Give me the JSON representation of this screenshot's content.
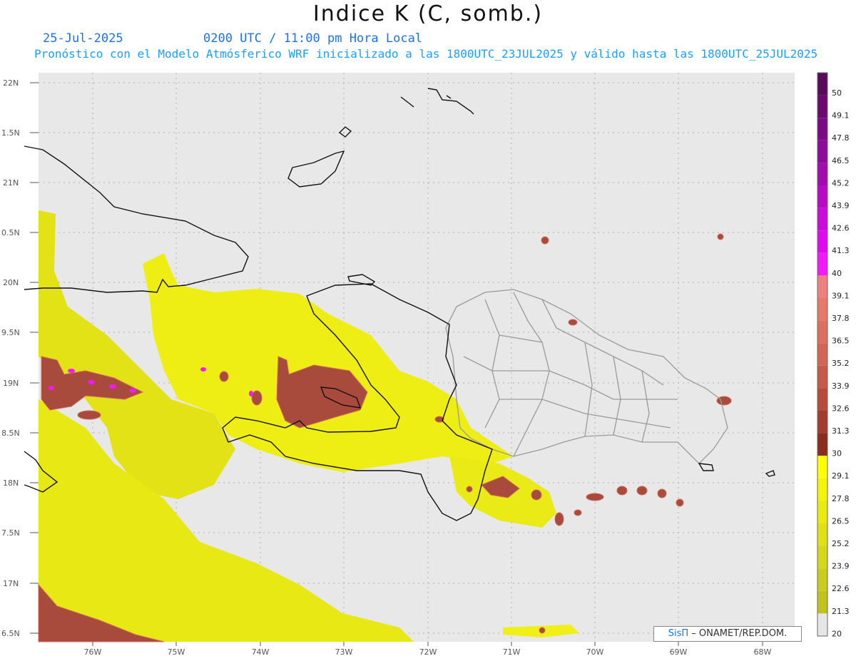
{
  "header": {
    "title": "Indice K (C, somb.)",
    "date": "25-Jul-2025",
    "time": "0200 UTC / 11:00 pm Hora Local",
    "subtitle": "Pronóstico con el Modelo Atmósferico WRF inicializado a las 1800UTC_23JUL2025 y válido hasta las  1800UTC_25JUL2025"
  },
  "axes": {
    "lat_labels": [
      "22N",
      "1.5N",
      "21N",
      "0.5N",
      "20N",
      "9.5N",
      "19N",
      "8.5N",
      "18N",
      "7.5N",
      "17N",
      "6.5N"
    ],
    "lon_labels": [
      "76W",
      "75W",
      "74W",
      "73W",
      "72W",
      "71W",
      "70W",
      "69W",
      "68W"
    ]
  },
  "colorbar": {
    "labels": [
      "50",
      "49.1",
      "47.8",
      "46.5",
      "45.2",
      "43.9",
      "42.6",
      "41.3",
      "40",
      "39.1",
      "37.8",
      "36.5",
      "35.2",
      "33.9",
      "32.6",
      "31.3",
      "30",
      "29.1",
      "27.8",
      "26.5",
      "25.2",
      "23.9",
      "22.6",
      "21.3",
      "20"
    ],
    "colors": [
      "#5a0a5a",
      "#6a0a6e",
      "#7c0a84",
      "#8e0a9a",
      "#a30ab0",
      "#b80ac6",
      "#cc0adc",
      "#e00af0",
      "#f21af8",
      "#f08080",
      "#e8786a",
      "#df6e5e",
      "#d56454",
      "#c85848",
      "#b84a3c",
      "#a33c2e",
      "#8c2c1e",
      "#ffff00",
      "#f4f40a",
      "#eaea10",
      "#e0e016",
      "#d6d61a",
      "#cccc1c",
      "#c2c21c",
      "#e6e6e6"
    ]
  },
  "credit": {
    "logo": "SisΠ",
    "text": " – ONAMET/REP.DOM."
  },
  "colors": {
    "background": "#e8e8e8",
    "yellow_low": "#cdcd1c",
    "yellow_high": "#ffff1a",
    "brown": "#a84a3c",
    "magenta": "#f21af8"
  }
}
